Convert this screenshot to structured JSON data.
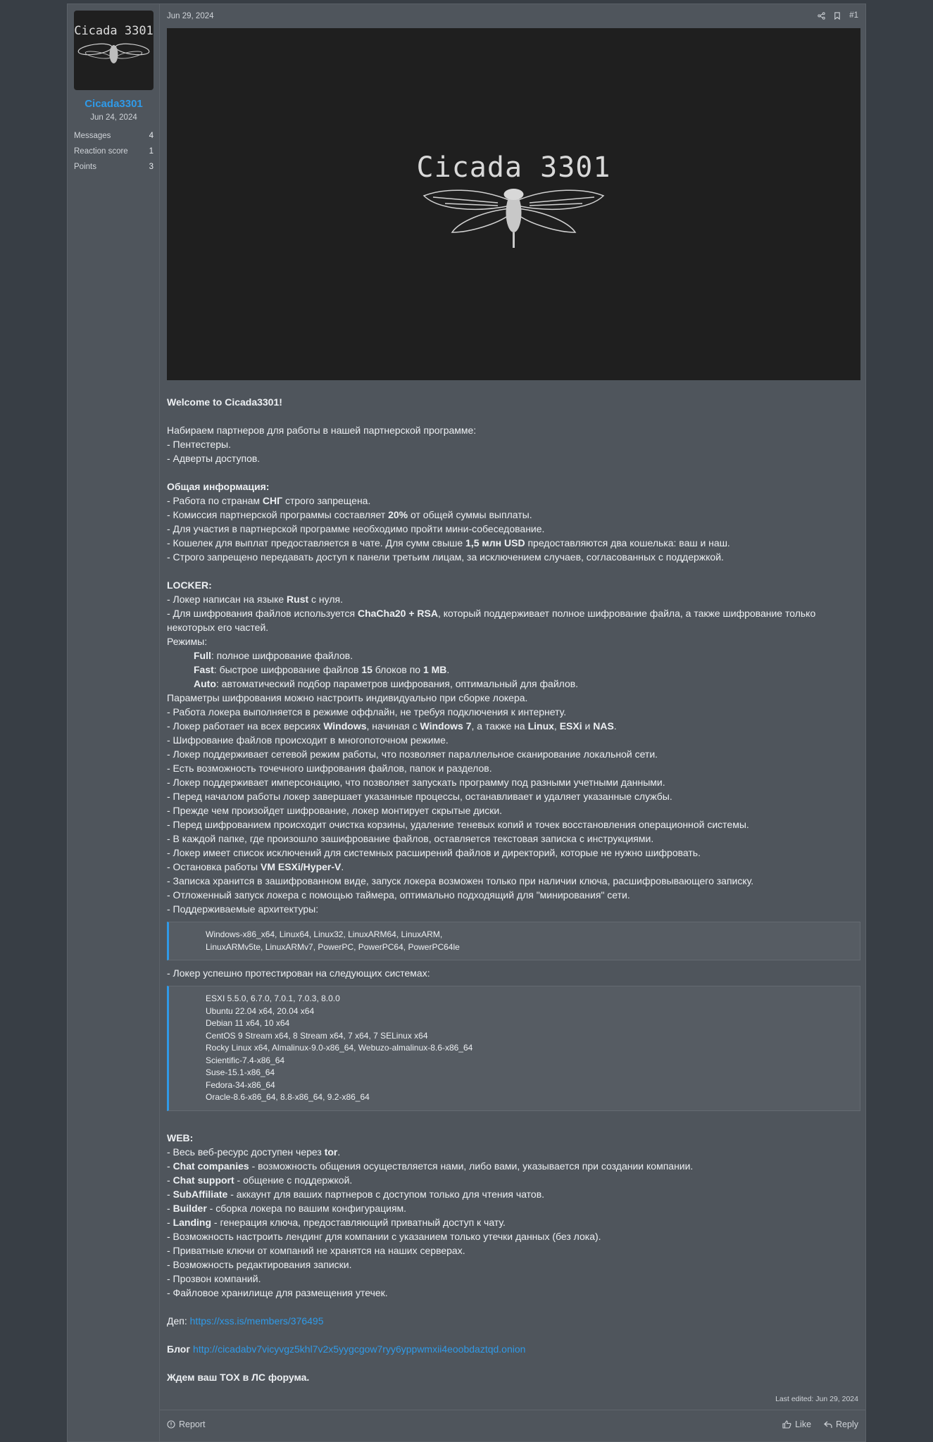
{
  "user": {
    "avatar_text": "Cicada 3301",
    "name": "Cicada3301",
    "joined": "Jun 24, 2024",
    "stats": [
      {
        "label": "Messages",
        "value": "4"
      },
      {
        "label": "Reaction score",
        "value": "1"
      },
      {
        "label": "Points",
        "value": "3"
      }
    ]
  },
  "post": {
    "date": "Jun 29, 2024",
    "number": "#1",
    "banner_title": "Cicada 3301",
    "welcome": "Welcome to Cicada3301!",
    "recruit": [
      "Набираем партнеров для работы в нашей партнерской программе:",
      "- Пентестеры.",
      "- Адверты доступов."
    ],
    "general_title": "Общая информация:",
    "locker_title": "LOCKER:",
    "modes_title": "Режимы:",
    "archs": "Windows-x86_x64, Linux64, Linux32, LinuxARM64, LinuxARM, LinuxARMv5te, LinuxARMv7, PowerPC, PowerPC64, PowerPC64le",
    "tested_title": "- Локер успешно протестирован на следующих системах:",
    "tested": [
      "ESXI 5.5.0, 6.7.0, 7.0.1, 7.0.3, 8.0.0",
      "Ubuntu 22.04 x64, 20.04 x64",
      "Debian 11 x64, 10 x64",
      "CentOS 9 Stream x64, 8 Stream x64, 7 x64, 7 SELinux x64",
      "Rocky Linux x64, Almalinux-9.0-x86_64, Webuzo-almalinux-8.6-x86_64",
      "Scientific-7.4-x86_64",
      "Suse-15.1-x86_64",
      "Fedora-34-x86_64",
      "Oracle-8.6-x86_64, 8.8-x86_64, 9.2-x86_64"
    ],
    "web_title": "WEB:",
    "dep_label": "Деп:",
    "dep_link": "https://xss.is/members/376495",
    "blog_label": "Блог",
    "blog_link": "http://cicadabv7vicyvgz5khl7v2x5yygcgow7ryy6yppwmxii4eoobdaztqd.onion",
    "closing": "Ждем ваш TOX в ЛС форума.",
    "last_edited": "Last edited: Jun 29, 2024"
  },
  "footer": {
    "report": "Report",
    "like": "Like",
    "reply": "Reply"
  }
}
